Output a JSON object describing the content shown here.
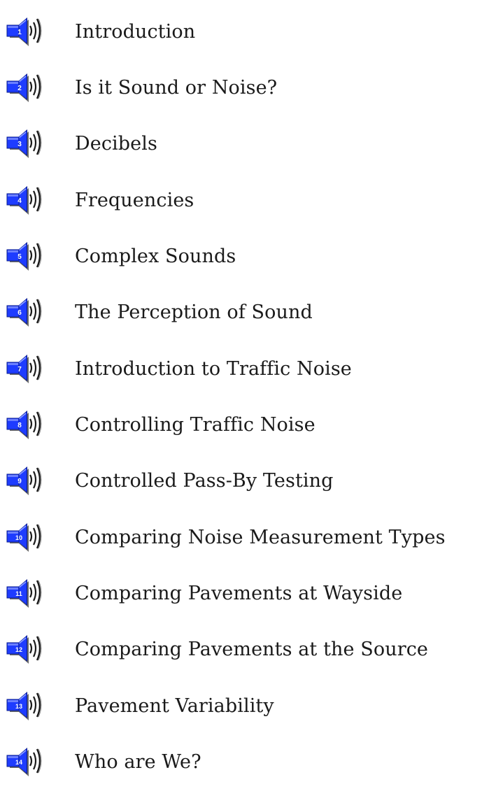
{
  "colors": {
    "speaker_blue": "#1e3cff",
    "speaker_dark": "#0a1c8c",
    "waves": "#1a1a1a",
    "text": "#1a1a1a"
  },
  "icon": "speaker-audio-icon",
  "items": [
    {
      "number": "1",
      "label": "Introduction"
    },
    {
      "number": "2",
      "label": "Is it Sound or Noise?"
    },
    {
      "number": "3",
      "label": "Decibels"
    },
    {
      "number": "4",
      "label": "Frequencies"
    },
    {
      "number": "5",
      "label": "Complex Sounds"
    },
    {
      "number": "6",
      "label": "The Perception of Sound"
    },
    {
      "number": "7",
      "label": "Introduction to Traffic Noise"
    },
    {
      "number": "8",
      "label": "Controlling Traffic Noise"
    },
    {
      "number": "9",
      "label": "Controlled Pass-By Testing"
    },
    {
      "number": "10",
      "label": "Comparing Noise Measurement Types"
    },
    {
      "number": "11",
      "label": "Comparing Pavements at Wayside"
    },
    {
      "number": "12",
      "label": "Comparing Pavements at the Source"
    },
    {
      "number": "13",
      "label": "Pavement Variability"
    },
    {
      "number": "14",
      "label": "Who are We?"
    }
  ]
}
